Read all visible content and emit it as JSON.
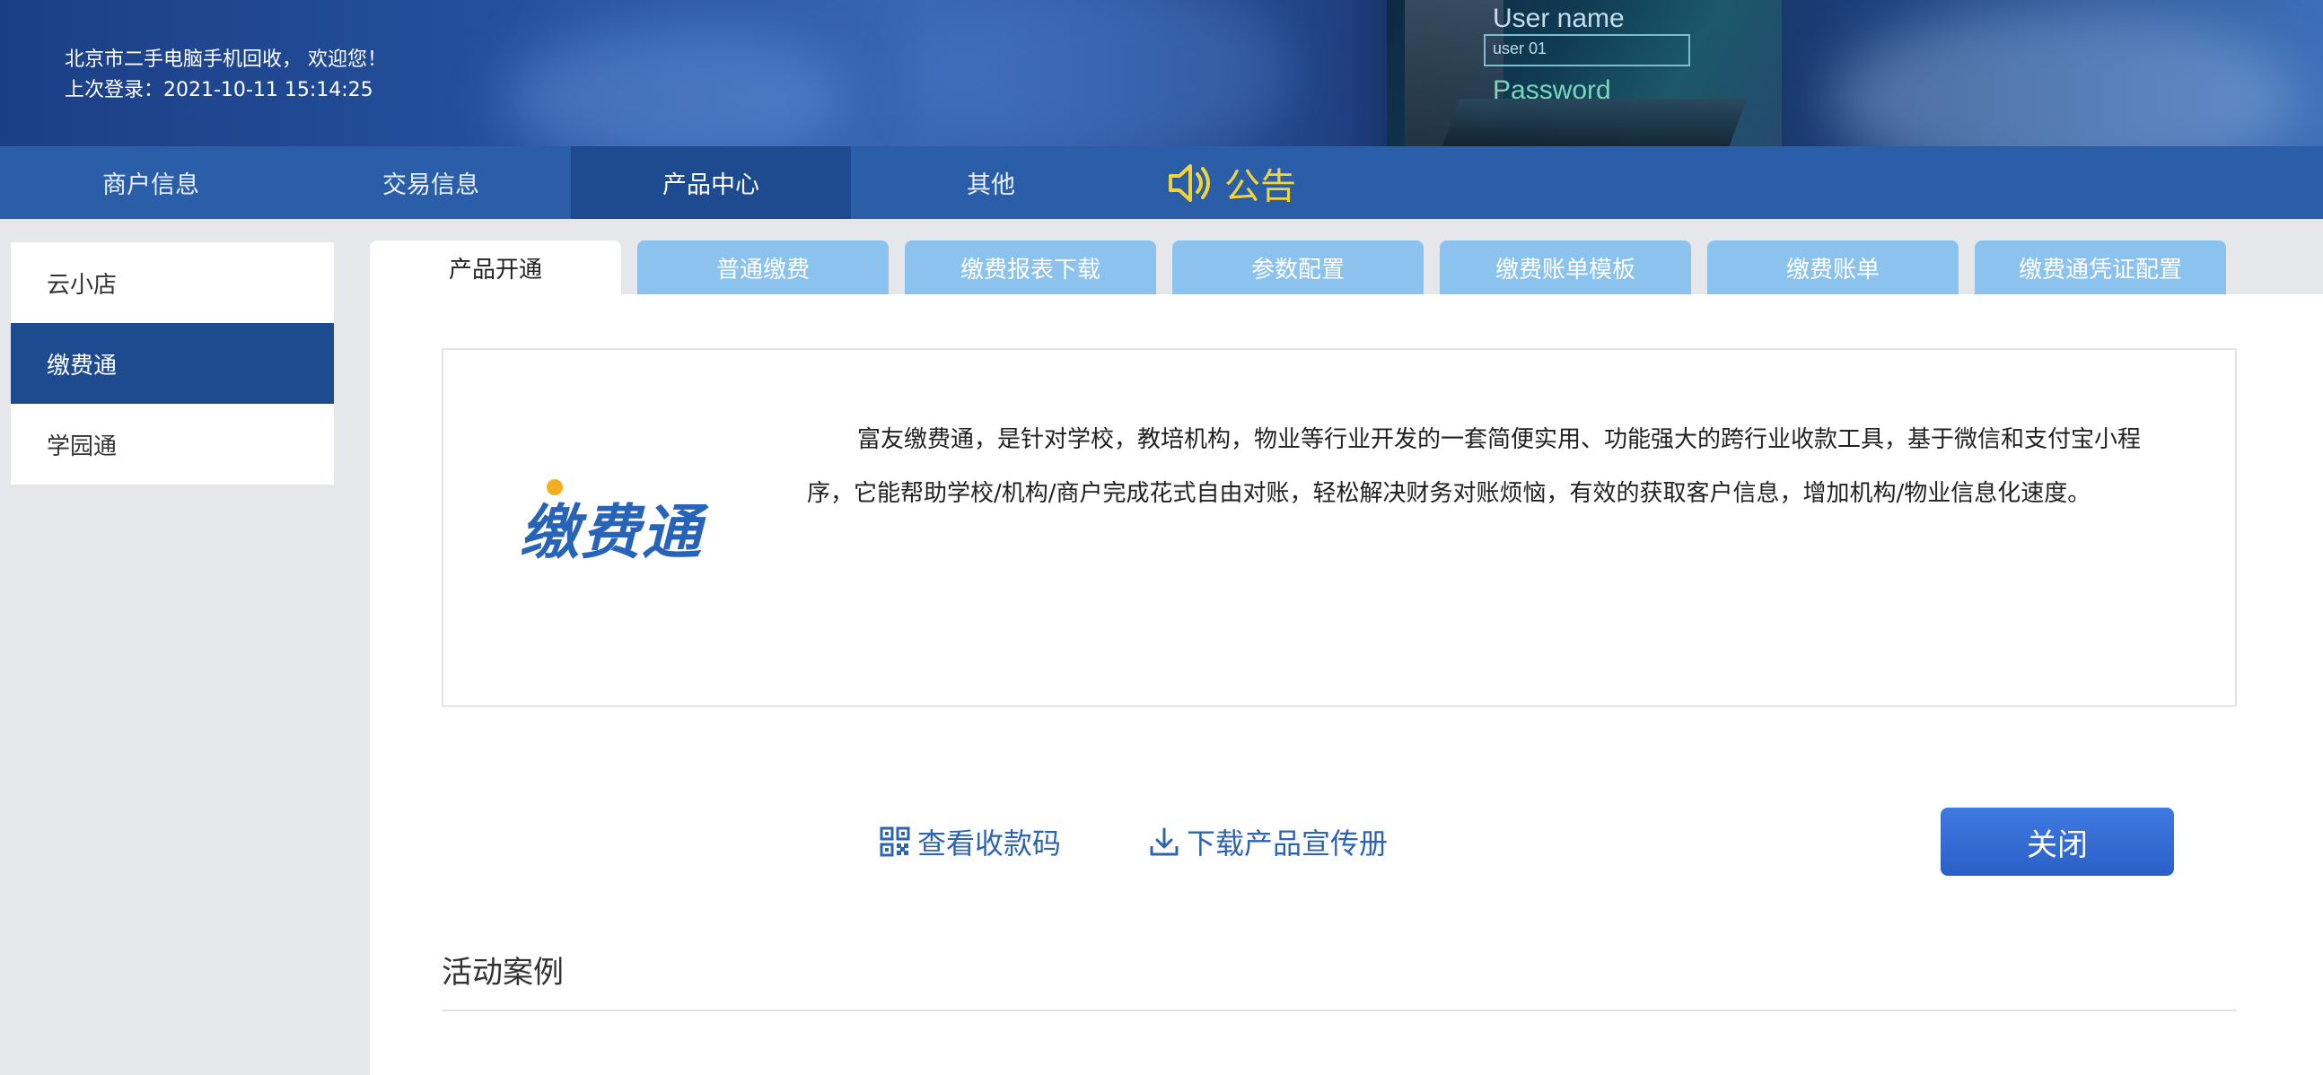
{
  "header": {
    "greeting": "北京市二手电脑手机回收， 欢迎您！",
    "last_login": "上次登录：2021-10-11 15:14:25",
    "banner_username_label": "User name",
    "banner_user_value": "user 01",
    "banner_password_label": "Password"
  },
  "nav": {
    "items": [
      {
        "label": "商户信息"
      },
      {
        "label": "交易信息"
      },
      {
        "label": "产品中心"
      },
      {
        "label": "其他"
      }
    ],
    "active": "产品中心",
    "notice_label": "公告",
    "notice_icon": "speaker-icon"
  },
  "sidebar": {
    "items": [
      {
        "label": "云小店"
      },
      {
        "label": "缴费通"
      },
      {
        "label": "学园通"
      }
    ],
    "active": "缴费通"
  },
  "tabs": {
    "items": [
      {
        "label": "产品开通"
      },
      {
        "label": "普通缴费"
      },
      {
        "label": "缴费报表下载"
      },
      {
        "label": "参数配置"
      },
      {
        "label": "缴费账单模板"
      },
      {
        "label": "缴费账单"
      },
      {
        "label": "缴费通凭证配置"
      }
    ],
    "active": "产品开通"
  },
  "product": {
    "logo_text": "缴费通",
    "description": "富友缴费通，是针对学校，教培机构，物业等行业开发的一套简便实用、功能强大的跨行业收款工具，基于微信和支付宝小程序，它能帮助学校/机构/商户完成花式自由对账，轻松解决财务对账烦恼，有效的获取客户信息，增加机构/物业信息化速度。"
  },
  "actions": {
    "view_qr_label": "查看收款码",
    "download_label": "下载产品宣传册",
    "close_label": "关闭"
  },
  "section": {
    "title": "活动案例"
  },
  "colors": {
    "nav_bg": "#2a5ea8",
    "nav_active": "#1e4a8f",
    "tab_bg": "#8cc3ee",
    "link": "#2d64b2",
    "close_button": "#3366d6",
    "notice": "#f2d43a"
  }
}
